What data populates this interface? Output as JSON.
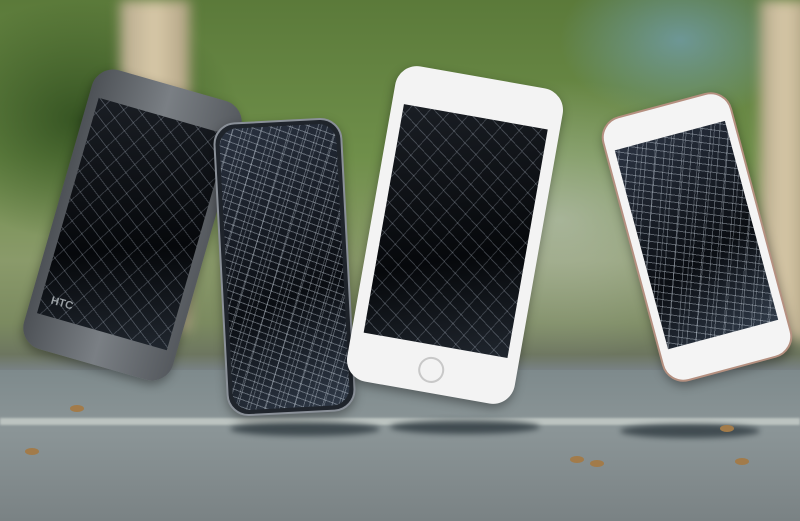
{
  "scene": {
    "description_colors": {
      "foliage": "#5b7a3a",
      "court": "#8b9597",
      "court_line": "#c9d0cc"
    },
    "phones": [
      {
        "brand_logo": "HTC",
        "color": "#5d6166",
        "screen_state": "cracked"
      },
      {
        "color": "#2a2f36",
        "screen_state": "heavily-cracked"
      },
      {
        "color": "#f2f2f2",
        "screen_state": "cracked"
      },
      {
        "color": "#f4f4f4",
        "screen_state": "heavily-cracked"
      }
    ]
  }
}
